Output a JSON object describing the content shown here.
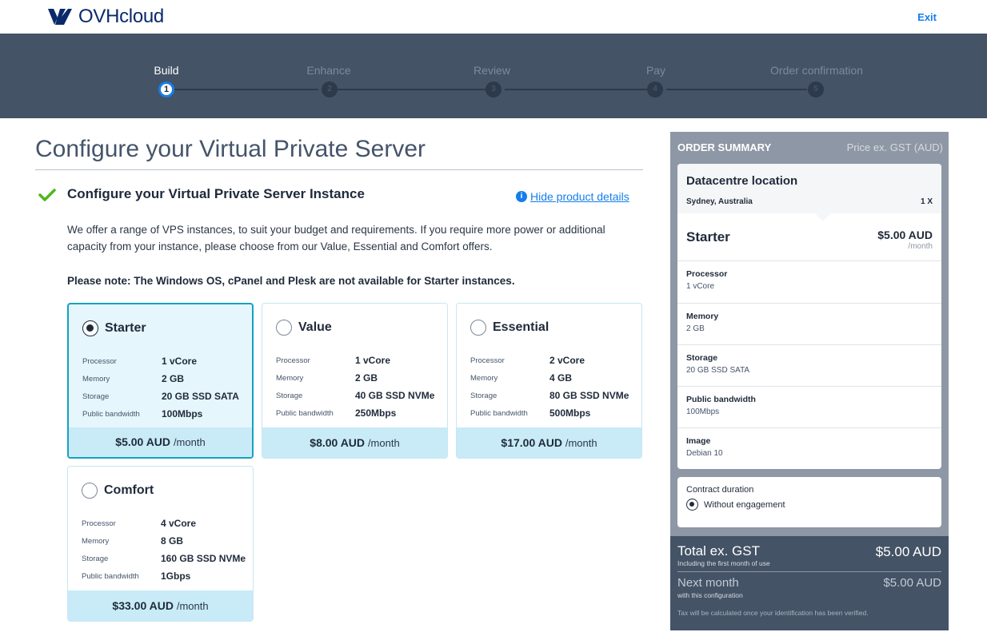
{
  "header": {
    "brand": "OVHcloud",
    "exit_label": "Exit"
  },
  "stepper": {
    "steps": [
      {
        "label": "Build",
        "num": "1"
      },
      {
        "label": "Enhance",
        "num": "2"
      },
      {
        "label": "Review",
        "num": "3"
      },
      {
        "label": "Pay",
        "num": "4"
      },
      {
        "label": "Order confirmation",
        "num": "5"
      }
    ],
    "active_step": 1
  },
  "main": {
    "title": "Configure your Virtual Private Server",
    "section_title": "Configure your Virtual Private Server Instance",
    "hide_details": "Hide product details",
    "intro": "We offer a range of VPS instances, to suit your budget and requirements. If you require more power or additional capacity from your instance, please choose from our Value, Essential and Comfort offers.",
    "note": "Please note: The Windows OS, cPanel and Plesk are not available for Starter instances.",
    "spec_labels": {
      "processor": "Processor",
      "memory": "Memory",
      "storage": "Storage",
      "bandwidth": "Public bandwidth"
    },
    "per_month": "/month",
    "plans": [
      {
        "name": "Starter",
        "processor": "1 vCore",
        "memory": "2 GB",
        "storage": "20 GB SSD SATA",
        "bandwidth": "100Mbps",
        "price": "$5.00 AUD",
        "selected": true
      },
      {
        "name": "Value",
        "processor": "1 vCore",
        "memory": "2 GB",
        "storage": "40 GB SSD NVMe",
        "bandwidth": "250Mbps",
        "price": "$8.00 AUD",
        "selected": false
      },
      {
        "name": "Essential",
        "processor": "2 vCore",
        "memory": "4 GB",
        "storage": "80 GB SSD NVMe",
        "bandwidth": "500Mbps",
        "price": "$17.00 AUD",
        "selected": false
      },
      {
        "name": "Comfort",
        "processor": "4 vCore",
        "memory": "8 GB",
        "storage": "160 GB SSD NVMe",
        "bandwidth": "1Gbps",
        "price": "$33.00 AUD",
        "selected": false
      }
    ]
  },
  "summary": {
    "title": "ORDER SUMMARY",
    "price_note": "Price ex. GST (AUD)",
    "datacentre_title": "Datacentre location",
    "datacentre": "Sydney, Australia",
    "quantity": "1 X",
    "product": "Starter",
    "product_price": "$5.00 AUD",
    "product_period": "/month",
    "items": [
      {
        "label": "Processor",
        "value": "1 vCore"
      },
      {
        "label": "Memory",
        "value": "2 GB"
      },
      {
        "label": "Storage",
        "value": "20 GB SSD SATA"
      },
      {
        "label": "Public bandwidth",
        "value": "100Mbps"
      },
      {
        "label": "Image",
        "value": "Debian 10"
      }
    ],
    "contract_title": "Contract duration",
    "contract_option": "Without engagement",
    "total_label": "Total ex. GST",
    "total_sub": "Including the first month of use",
    "total_amount": "$5.00 AUD",
    "next_label": "Next month",
    "next_sub": "with this configuration",
    "next_amount": "$5.00 AUD",
    "tax_note": "Tax will be calculated once your identification has been verified."
  },
  "colors": {
    "accent": "#157eea",
    "stepper_bg": "#445366",
    "selected_border": "#16a1c0",
    "price_band": "#c8ebf7",
    "success": "#4fb71e"
  }
}
